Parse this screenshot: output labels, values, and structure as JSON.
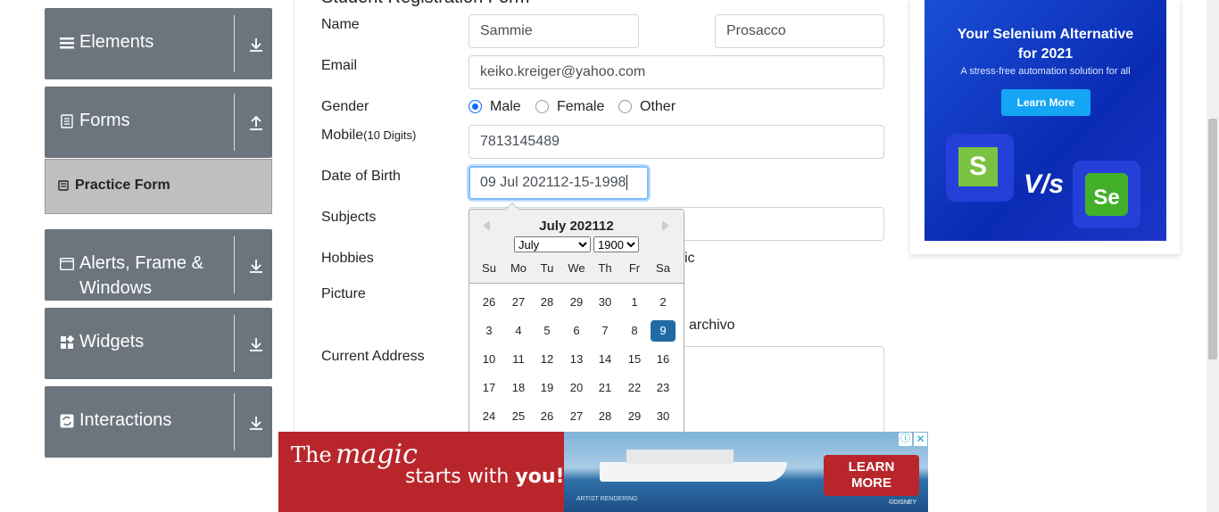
{
  "sidebar": {
    "groups": [
      {
        "title": "Elements",
        "icon": "menu-icon",
        "arrow": "download-arrow-icon"
      },
      {
        "title": "Forms",
        "icon": "document-icon",
        "arrow": "upload-arrow-icon"
      },
      {
        "title_line1": "Alerts, Frame &",
        "title_line2": "Windows",
        "icon": "window-icon",
        "arrow": "download-arrow-icon"
      },
      {
        "title": "Widgets",
        "icon": "widgets-icon",
        "arrow": "download-arrow-icon"
      },
      {
        "title": "Interactions",
        "icon": "interactions-icon",
        "arrow": "download-arrow-icon"
      }
    ],
    "active_item": "Practice Form"
  },
  "form": {
    "heading_partial": "Student Registration Form",
    "name_label": "Name",
    "first_name": "Sammie",
    "last_name": "Prosacco",
    "email_label": "Email",
    "email": "keiko.kreiger@yahoo.com",
    "gender_label": "Gender",
    "gender_options": [
      "Male",
      "Female",
      "Other"
    ],
    "mobile_label": "Mobile",
    "mobile_hint": "(10 Digits)",
    "mobile": "7813145489",
    "dob_label": "Date of Birth",
    "dob_value": "09 Jul 202112-15-1998",
    "subjects_label": "Subjects",
    "hobbies_label": "Hobbies",
    "hobbies_partial": "ic",
    "picture_label": "Picture",
    "file_partial": "archivo",
    "address_label": "Current Address"
  },
  "calendar": {
    "title": "July 202112",
    "month_select": "July",
    "year_select": "1900",
    "weekdays": [
      "Su",
      "Mo",
      "Tu",
      "We",
      "Th",
      "Fr",
      "Sa"
    ],
    "weeks": [
      [
        "26",
        "27",
        "28",
        "29",
        "30",
        "1",
        "2"
      ],
      [
        "3",
        "4",
        "5",
        "6",
        "7",
        "8",
        "9"
      ],
      [
        "10",
        "11",
        "12",
        "13",
        "14",
        "15",
        "16"
      ],
      [
        "17",
        "18",
        "19",
        "20",
        "21",
        "22",
        "23"
      ],
      [
        "24",
        "25",
        "26",
        "27",
        "28",
        "29",
        "30"
      ]
    ],
    "selected_day": "9"
  },
  "ad_right": {
    "headline_line1": "Your Selenium Alternative",
    "headline_line2": "for 2021",
    "tagline": "A stress-free automation solution for all",
    "button": "Learn More",
    "logo_left": "S",
    "vs": "V/s",
    "logo_right": "Se"
  },
  "ad_bottom": {
    "the": "The",
    "magic": "magic",
    "starts": "starts with",
    "you": "you!",
    "button_line1": "LEARN",
    "button_line2": "MORE",
    "artist": "ARTIST RENDERING",
    "brand": "©DISNEY"
  },
  "colors": {
    "sidebar_group": "#6c757d",
    "active_item": "#bfbfbf",
    "selected_day": "#216ba5",
    "ad_red": "#b8262b",
    "ad_blue": "#0a2bb3"
  }
}
